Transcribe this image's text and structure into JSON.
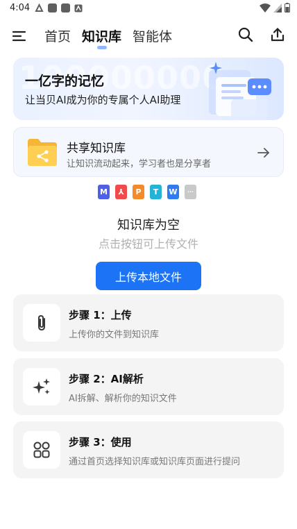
{
  "status": {
    "time": "4:04"
  },
  "nav": {
    "tabs": [
      {
        "label": "首页",
        "active": false
      },
      {
        "label": "知识库",
        "active": true
      },
      {
        "label": "智能体",
        "active": false
      }
    ]
  },
  "banner": {
    "bg_number": "100000000",
    "title": "一亿字的记忆",
    "subtitle": "让当贝AI成为你的专属个人AI助理"
  },
  "share": {
    "title": "共享知识库",
    "subtitle": "让知识流动起来，学习者也是分享者"
  },
  "file_types": [
    {
      "letter": "M",
      "color": "#4f5fe6",
      "icon": "markdown-file-icon"
    },
    {
      "letter": "⅄",
      "color": "#ef4b4b",
      "icon": "pdf-file-icon"
    },
    {
      "letter": "P",
      "color": "#f58a2a",
      "icon": "ppt-file-icon"
    },
    {
      "letter": "T",
      "color": "#22b3d6",
      "icon": "txt-file-icon"
    },
    {
      "letter": "W",
      "color": "#2f7cf0",
      "icon": "word-file-icon"
    },
    {
      "letter": "···",
      "color": "#c9c9c9",
      "icon": "other-file-icon"
    }
  ],
  "empty": {
    "title": "知识库为空",
    "subtitle": "点击按钮可上传文件"
  },
  "upload_button": "上传本地文件",
  "steps": [
    {
      "title": "步骤 1：上传",
      "desc": "上传你的文件到知识库",
      "icon": "paperclip-icon"
    },
    {
      "title": "步骤 2：AI解析",
      "desc": "AI拆解、解析你的知识文件",
      "icon": "sparkle-icon"
    },
    {
      "title": "步骤 3：使用",
      "desc": "通过首页选择知识库或知识库页面进行提问",
      "icon": "apps-grid-icon"
    }
  ],
  "colors": {
    "accent": "#1c73f5",
    "card_bg": "#f4f4f4"
  }
}
